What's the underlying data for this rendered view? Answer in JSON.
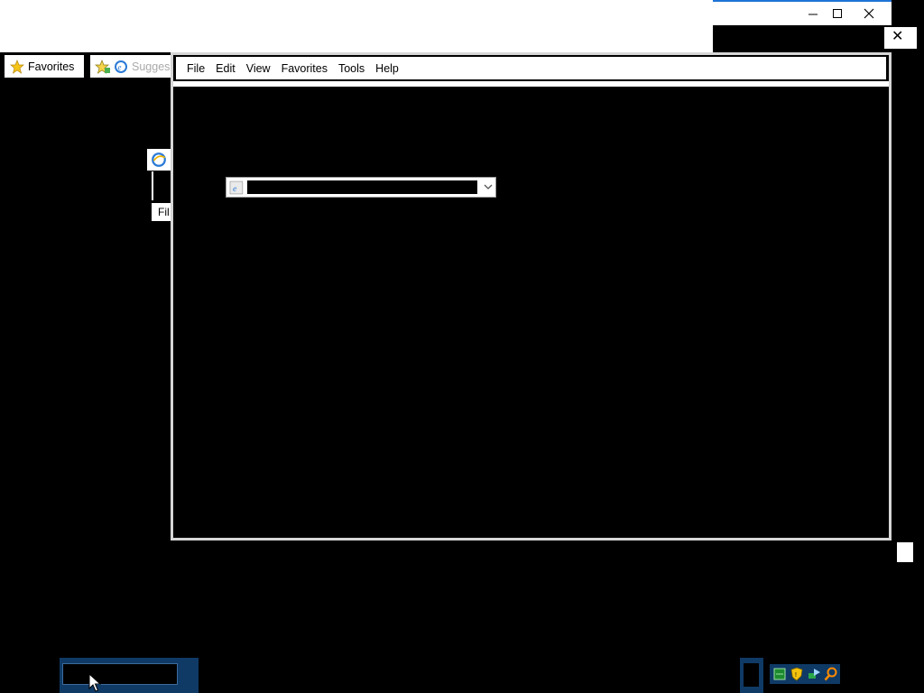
{
  "window": {
    "controls": [
      "minimize",
      "maximize",
      "close"
    ],
    "close_glyph": "✕"
  },
  "favorites_bar": {
    "favorites_label": "Favorites",
    "suggested_label": "Sugges",
    "icons": [
      "star-icon",
      "add-favorite-icon",
      "ie-icon"
    ]
  },
  "background_window": {
    "file_tab_label": "Fil"
  },
  "main_window": {
    "menu": [
      "File",
      "Edit",
      "View",
      "Favorites",
      "Tools",
      "Help"
    ],
    "address": {
      "value": "",
      "placeholder": ""
    }
  },
  "taskbar": {
    "tray_icons": [
      "green-app-icon",
      "security-shield-icon",
      "network-icon",
      "search-icon"
    ]
  },
  "colors": {
    "accent": "#1e73d6",
    "taskbar": "#0f3a66",
    "background": "#000000"
  }
}
